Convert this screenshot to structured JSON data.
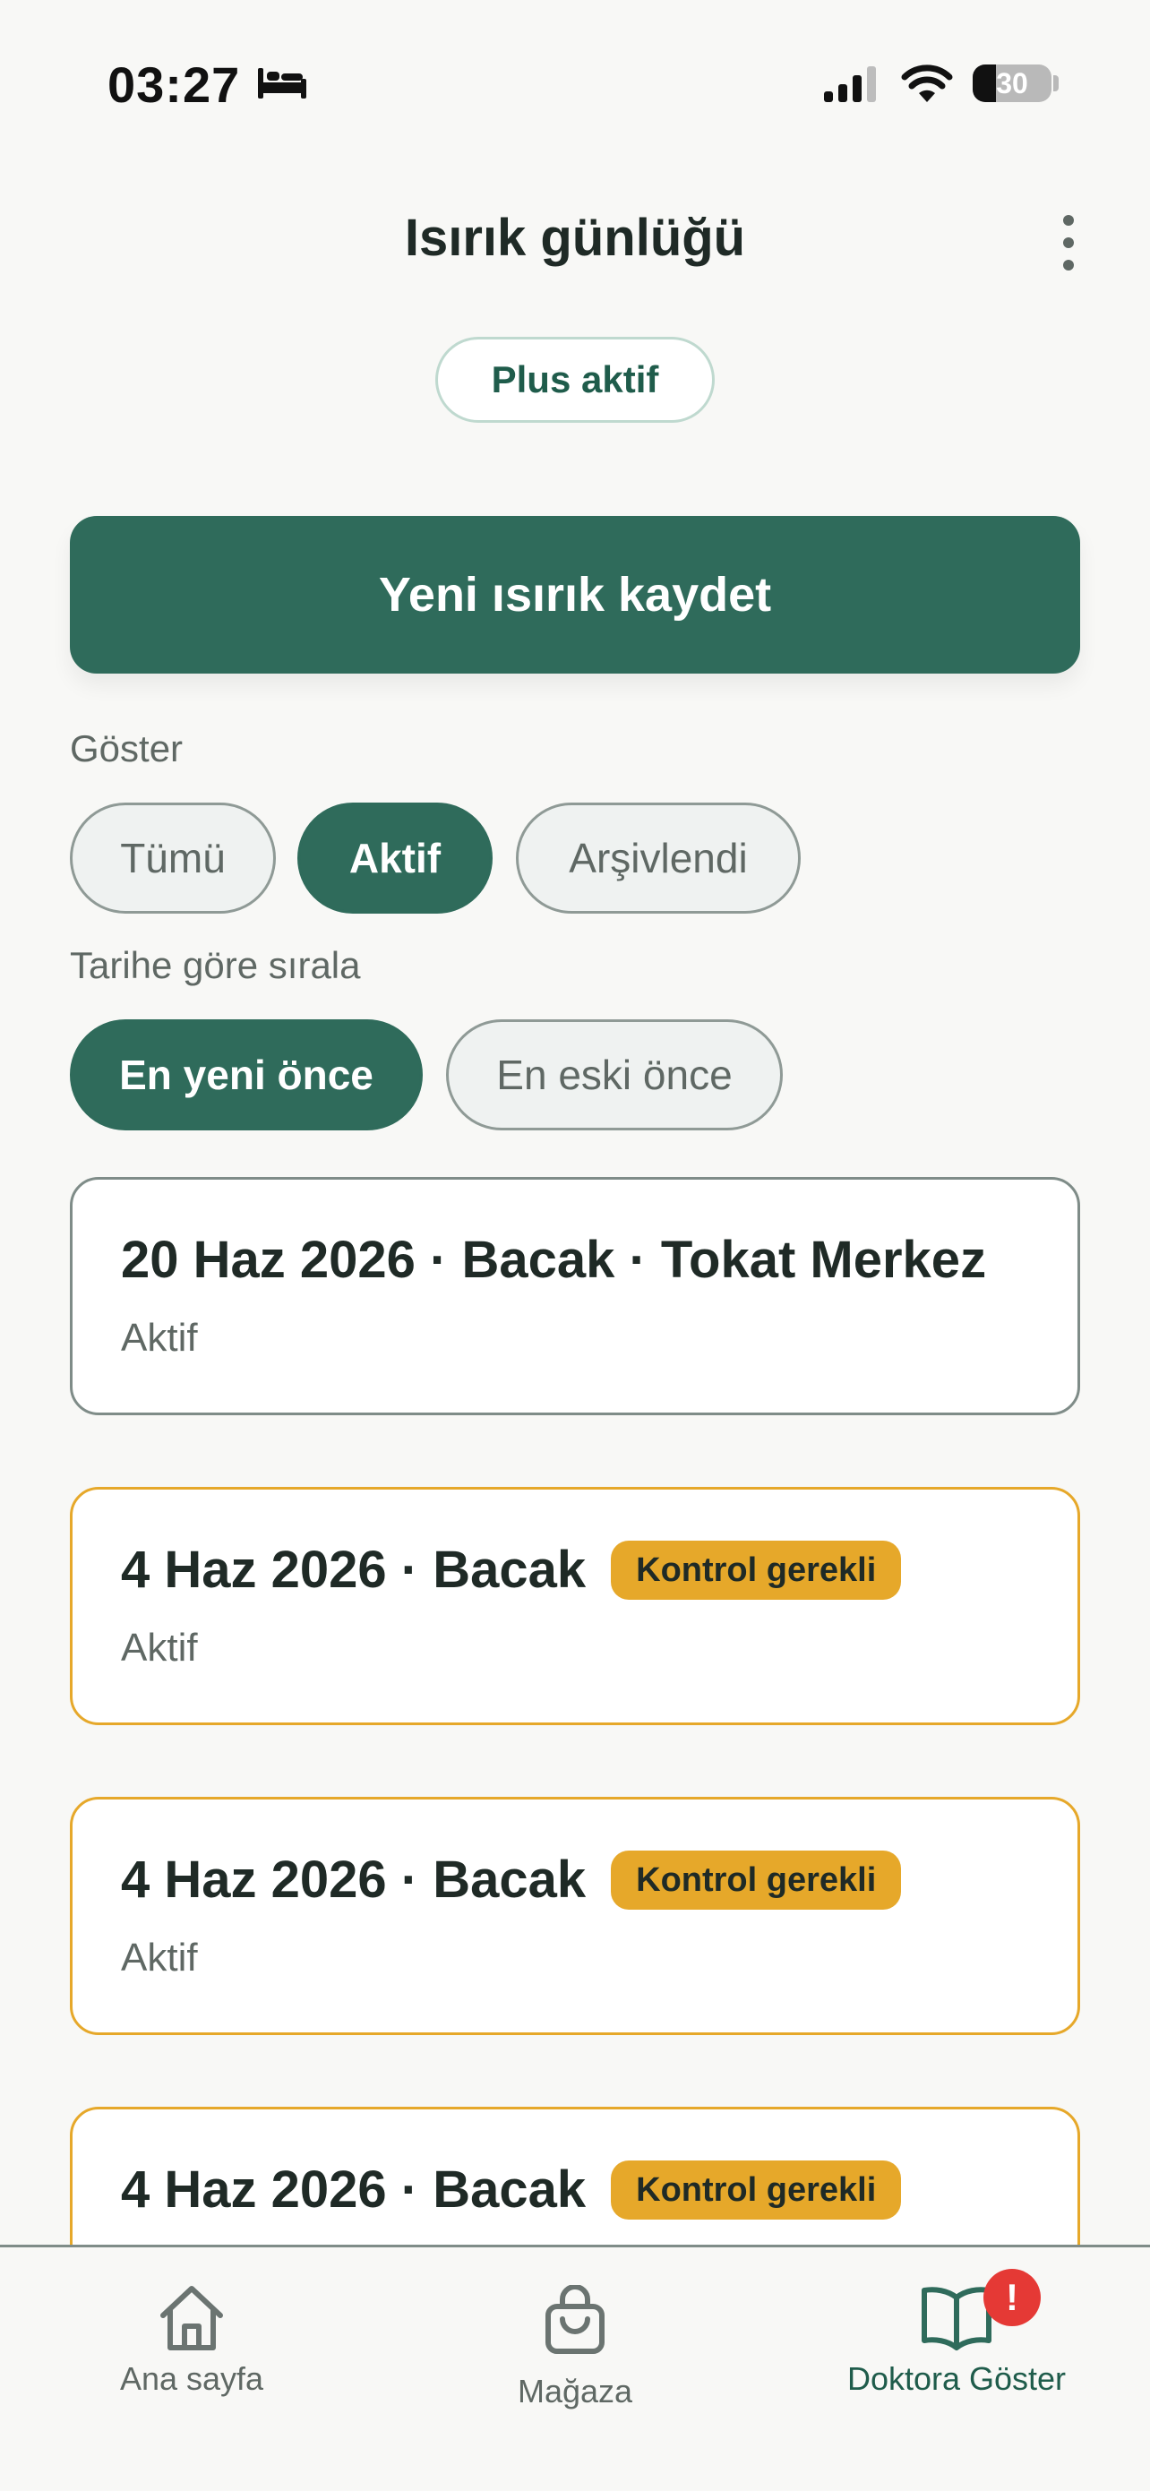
{
  "status_bar": {
    "time": "03:27",
    "battery": "30",
    "battery_level": 0.3,
    "icons": [
      "bed-icon",
      "cellular-signal-icon",
      "wifi-icon",
      "battery-icon"
    ]
  },
  "header": {
    "title": "Isırık günlüğü",
    "menu_icon": "more-vertical-icon"
  },
  "plan_badge": "Plus aktif",
  "primary_action": "Yeni ısırık kaydet",
  "filters": {
    "show_label": "Göster",
    "show_options": [
      {
        "label": "Tümü",
        "selected": false
      },
      {
        "label": "Aktif",
        "selected": true
      },
      {
        "label": "Arşivlendi",
        "selected": false
      }
    ],
    "sort_label": "Tarihe göre sırala",
    "sort_options": [
      {
        "label": "En yeni önce",
        "selected": true
      },
      {
        "label": "En eski önce",
        "selected": false
      }
    ]
  },
  "entries": [
    {
      "title": "20 Haz 2026 · Bacak · Tokat Merkez",
      "status": "Aktif",
      "badge": null
    },
    {
      "title": "4 Haz 2026 · Bacak",
      "status": "Aktif",
      "badge": "Kontrol gerekli"
    },
    {
      "title": "4 Haz 2026 · Bacak",
      "status": "Aktif",
      "badge": "Kontrol gerekli"
    },
    {
      "title": "4 Haz 2026 · Bacak",
      "status": "",
      "badge": "Kontrol gerekli"
    }
  ],
  "bottom_nav": [
    {
      "label": "Ana sayfa",
      "icon": "home-icon",
      "active": false
    },
    {
      "label": "Mağaza",
      "icon": "shopping-bag-icon",
      "active": false
    },
    {
      "label": "Doktora Göster",
      "icon": "open-book-icon",
      "active": true,
      "alert": "!"
    }
  ],
  "colors": {
    "primary": "#2f6b5b",
    "warning": "#e6a82a",
    "alert": "#e53935",
    "background": "#f8f8f6"
  }
}
